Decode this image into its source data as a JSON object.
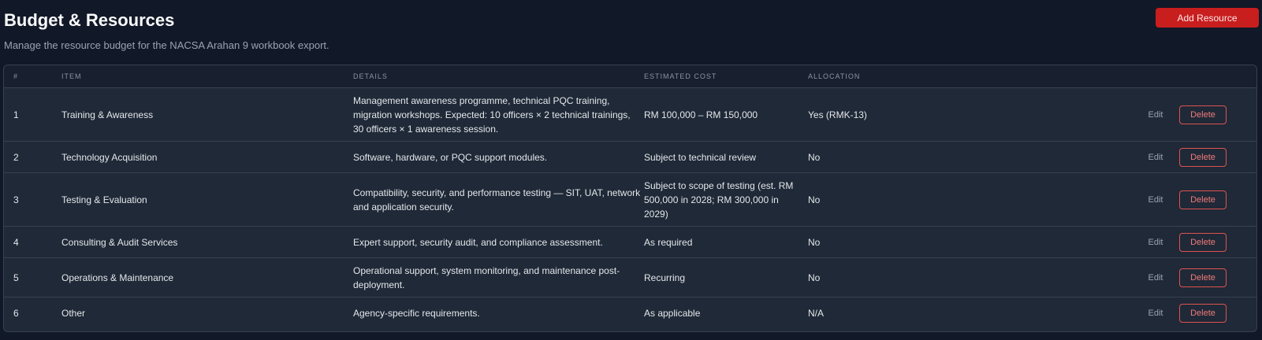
{
  "header": {
    "title": "Budget & Resources",
    "subtitle": "Manage the resource budget for the NACSA Arahan 9 workbook export.",
    "add_button_label": "Add Resource"
  },
  "table": {
    "columns": {
      "num": "#",
      "item": "ITEM",
      "details": "DETAILS",
      "cost": "ESTIMATED COST",
      "allocation": "ALLOCATION"
    },
    "edit_label": "Edit",
    "delete_label": "Delete",
    "rows": [
      {
        "num": "1",
        "item": "Training & Awareness",
        "details": "Management awareness programme, technical PQC training, migration workshops. Expected: 10 officers × 2 technical trainings, 30 officers × 1 awareness session.",
        "cost": "RM 100,000 – RM 150,000",
        "allocation": "Yes (RMK-13)"
      },
      {
        "num": "2",
        "item": "Technology Acquisition",
        "details": "Software, hardware, or PQC support modules.",
        "cost": "Subject to technical review",
        "allocation": "No"
      },
      {
        "num": "3",
        "item": "Testing & Evaluation",
        "details": "Compatibility, security, and performance testing — SIT, UAT, network and application security.",
        "cost": "Subject to scope of testing (est. RM 500,000 in 2028; RM 300,000 in 2029)",
        "allocation": "No"
      },
      {
        "num": "4",
        "item": "Consulting & Audit Services",
        "details": "Expert support, security audit, and compliance assessment.",
        "cost": "As required",
        "allocation": "No"
      },
      {
        "num": "5",
        "item": "Operations & Maintenance",
        "details": "Operational support, system monitoring, and maintenance post-deployment.",
        "cost": "Recurring",
        "allocation": "No"
      },
      {
        "num": "6",
        "item": "Other",
        "details": "Agency-specific requirements.",
        "cost": "As applicable",
        "allocation": "N/A"
      }
    ]
  }
}
